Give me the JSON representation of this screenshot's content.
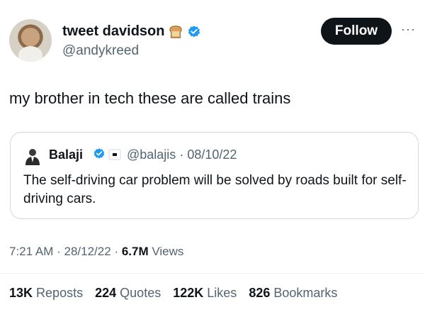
{
  "author": {
    "display_name": "tweet davidson",
    "handle": "@andykreed",
    "badge_icon": "verified-badge-icon",
    "emoji_icon": "bread-icon"
  },
  "actions": {
    "follow_label": "Follow",
    "more_label": "···"
  },
  "tweet": {
    "text": "my brother in tech these are called trains"
  },
  "quote": {
    "name": "Balaji",
    "handle": "@balajis",
    "date": "08/10/22",
    "separator": "·",
    "text": "The self-driving car problem will be solved by roads built for self-driving cars."
  },
  "meta": {
    "time": "7:21 AM",
    "sep1": "·",
    "date": "28/12/22",
    "sep2": "·",
    "views_count": "6.7M",
    "views_label": "Views"
  },
  "stats": [
    {
      "count": "13K",
      "label": "Reposts"
    },
    {
      "count": "224",
      "label": "Quotes"
    },
    {
      "count": "122K",
      "label": "Likes"
    },
    {
      "count": "826",
      "label": "Bookmarks"
    }
  ],
  "colors": {
    "verified": "#1d9bf0",
    "muted": "#536471",
    "text": "#0f1419"
  }
}
